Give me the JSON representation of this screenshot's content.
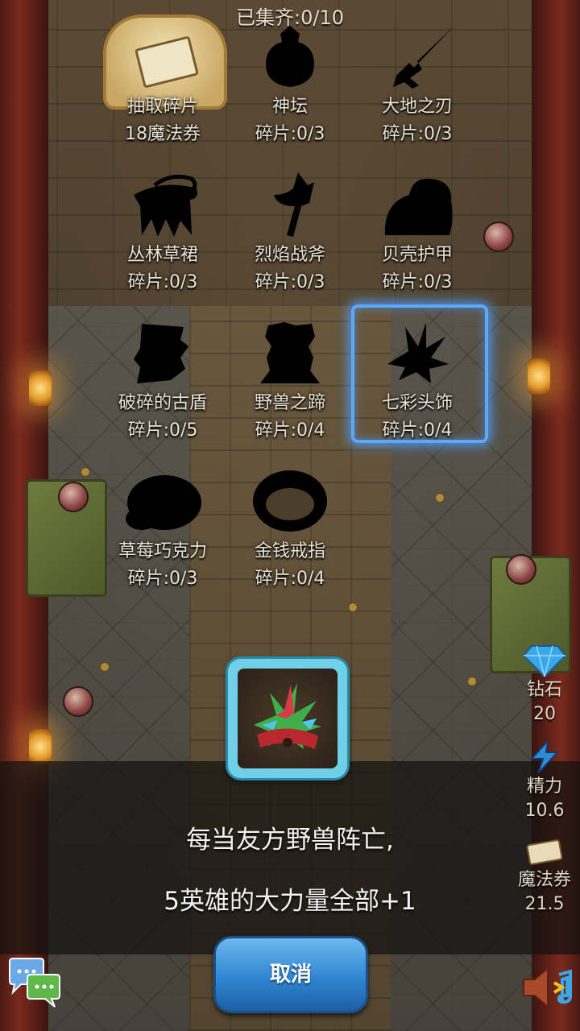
{
  "header": {
    "collected_text": "已集齐:0/10"
  },
  "fragments": [
    {
      "name": "抽取碎片",
      "count": "18魔法券",
      "icon": "ticket-icon"
    },
    {
      "name": "神坛",
      "count": "碎片:0/3",
      "icon": "altar-silhouette-icon"
    },
    {
      "name": "大地之刃",
      "count": "碎片:0/3",
      "icon": "blade-silhouette-icon"
    },
    {
      "name": "丛林草裙",
      "count": "碎片:0/3",
      "icon": "grass-skirt-silhouette-icon"
    },
    {
      "name": "烈焰战斧",
      "count": "碎片:0/3",
      "icon": "axe-silhouette-icon"
    },
    {
      "name": "贝壳护甲",
      "count": "碎片:0/3",
      "icon": "shell-armor-silhouette-icon"
    },
    {
      "name": "破碎的古盾",
      "count": "碎片:0/5",
      "icon": "shield-silhouette-icon"
    },
    {
      "name": "野兽之蹄",
      "count": "碎片:0/4",
      "icon": "hoof-silhouette-icon"
    },
    {
      "name": "七彩头饰",
      "count": "碎片:0/4",
      "icon": "headdress-silhouette-icon"
    },
    {
      "name": "草莓巧克力",
      "count": "碎片:0/3",
      "icon": "chocolate-silhouette-icon"
    },
    {
      "name": "金钱戒指",
      "count": "碎片:0/4",
      "icon": "ring-silhouette-icon"
    }
  ],
  "selected_index": 8,
  "detail": {
    "line1": "每当友方野兽阵亡,",
    "line2": "5英雄的大力量全部+1",
    "cancel_label": "取消"
  },
  "resources": [
    {
      "label": "钻石",
      "value": "20",
      "icon": "diamond-icon"
    },
    {
      "label": "精力",
      "value": "10.6",
      "icon": "energy-icon"
    },
    {
      "label": "魔法券",
      "value": "21.5",
      "icon": "magic-ticket-icon"
    }
  ],
  "colors": {
    "accent_blue": "#5aa8ff",
    "button_blue": "#2f86d2",
    "frame_cyan": "#70d0e8"
  }
}
